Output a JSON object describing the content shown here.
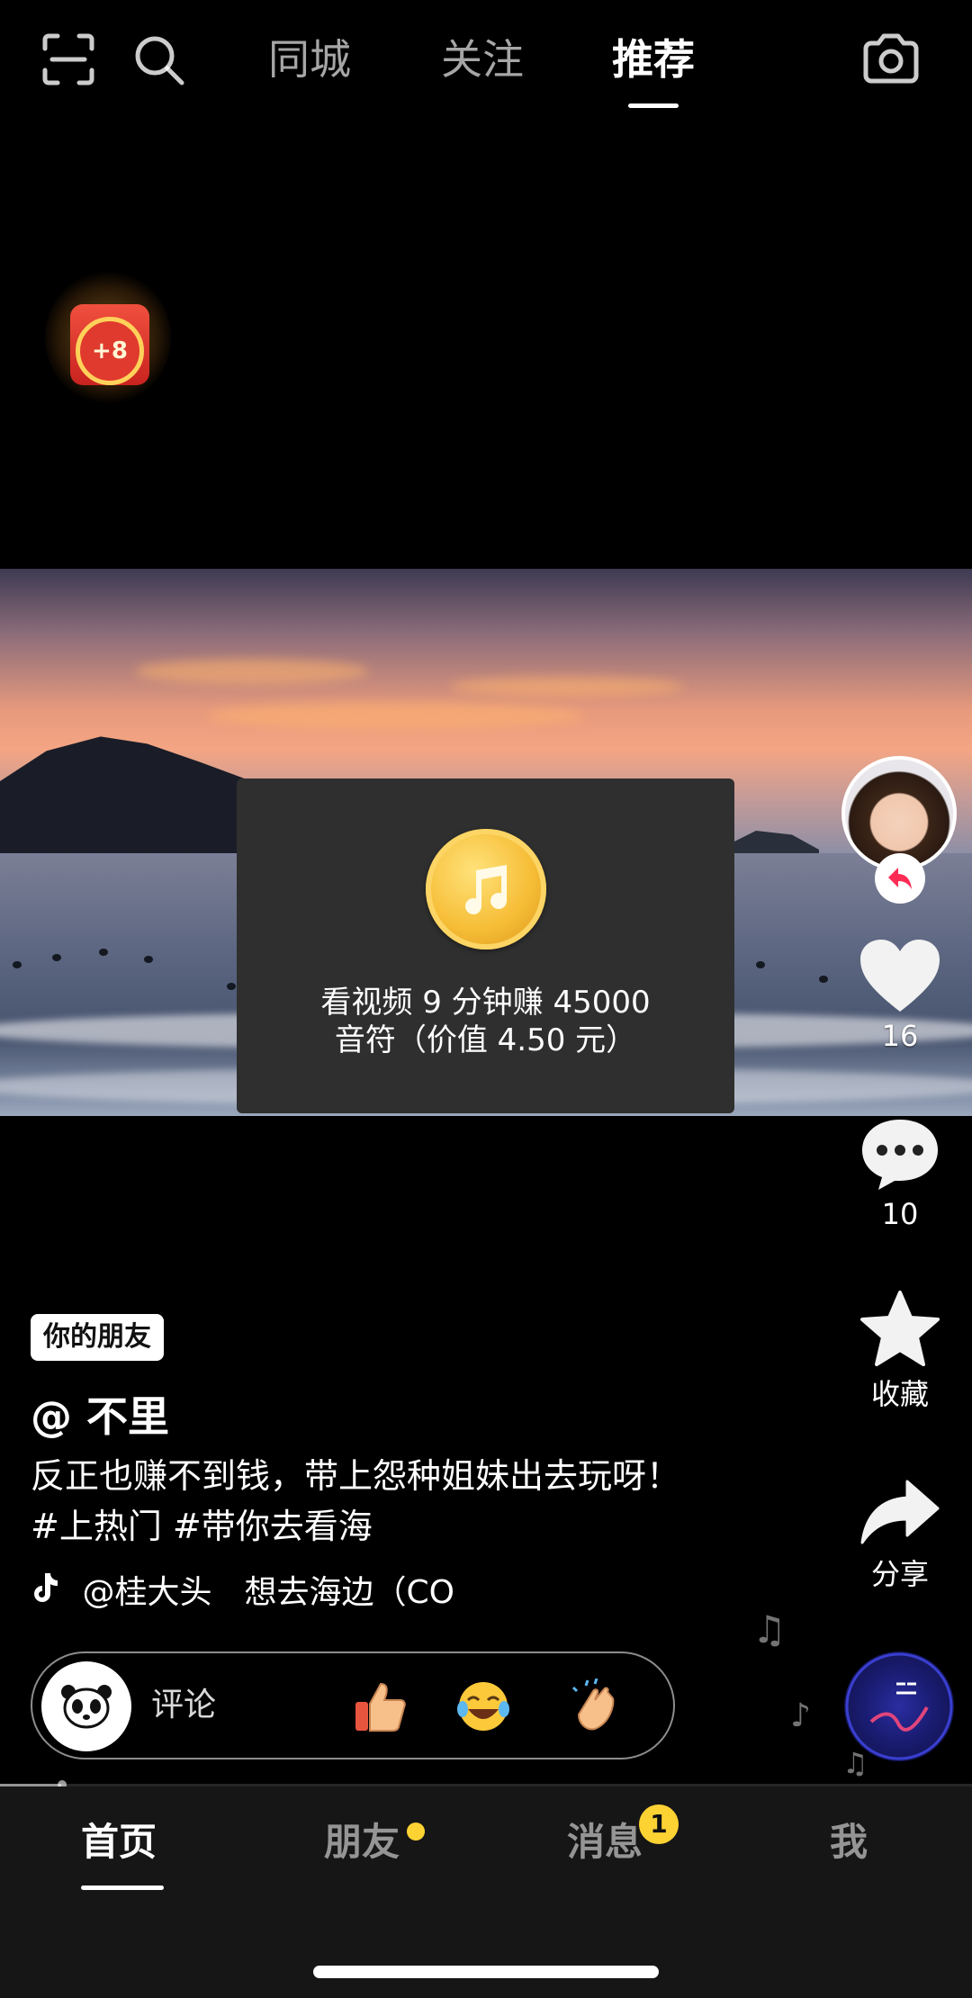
{
  "top_bar": {
    "tabs": [
      {
        "label": "同城",
        "active": false
      },
      {
        "label": "关注",
        "active": false
      },
      {
        "label": "推荐",
        "active": true
      }
    ],
    "icons": [
      "scan-icon",
      "search-icon",
      "camera-icon"
    ]
  },
  "reward_badge": {
    "label": "+8"
  },
  "popup": {
    "line1": "看视频 9 分钟赚 45000",
    "line2": "音符（价值 4.50 元）"
  },
  "right_rail": {
    "like_count": "16",
    "comment_count": "10",
    "favorite_label": "收藏",
    "share_label": "分享"
  },
  "caption": {
    "friend_tag": "你的朋友",
    "username": "@ 不里",
    "description": "反正也赚不到钱，带上怨种姐妹出去玩呀！#上热门 #带你去看海",
    "music": "@桂大头　想去海边（CO"
  },
  "comment_bar": {
    "placeholder": "评论",
    "emojis": [
      "thumbs-up-emoji",
      "laughing-tears-emoji",
      "clapping-emoji"
    ]
  },
  "bottom_nav": {
    "items": [
      {
        "label": "首页",
        "active": true
      },
      {
        "label": "朋友",
        "active": false,
        "dot": true
      },
      {
        "label": "消息",
        "active": false,
        "badge": "1"
      },
      {
        "label": "我",
        "active": false
      }
    ]
  },
  "colors": {
    "background": "#000000",
    "badge_yellow": "#fdd233",
    "popup_bg": "#2f2f2f",
    "coin_gold": "#f6bd36"
  }
}
